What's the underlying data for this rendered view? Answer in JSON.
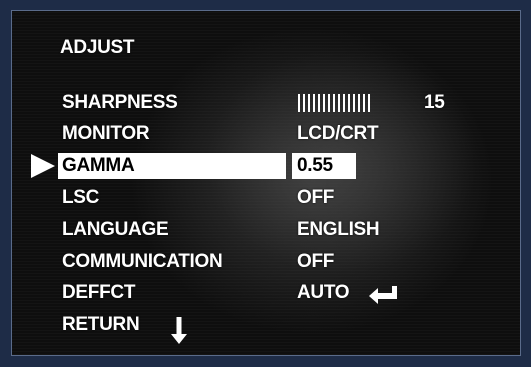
{
  "menu": {
    "title": "ADJUST",
    "selected_index": 2,
    "items": [
      {
        "label": "SHARPNESS",
        "value": "15",
        "value_display": "bar",
        "level": 15
      },
      {
        "label": "MONITOR",
        "value": "LCD/CRT"
      },
      {
        "label": "GAMMA",
        "value": "0.55"
      },
      {
        "label": "LSC",
        "value": "OFF"
      },
      {
        "label": "LANGUAGE",
        "value": "ENGLISH"
      },
      {
        "label": "COMMUNICATION",
        "value": "OFF"
      },
      {
        "label": "DEFFCT",
        "value": "AUTO",
        "icon": "enter-icon"
      },
      {
        "label": "RETURN",
        "icon": "down-arrow-icon"
      }
    ]
  },
  "colors": {
    "text": "#ffffff",
    "selection_bg": "#ffffff",
    "selection_text": "#000000",
    "screen_bg": "#0e0e0e",
    "bezel": "#1e2c47"
  }
}
